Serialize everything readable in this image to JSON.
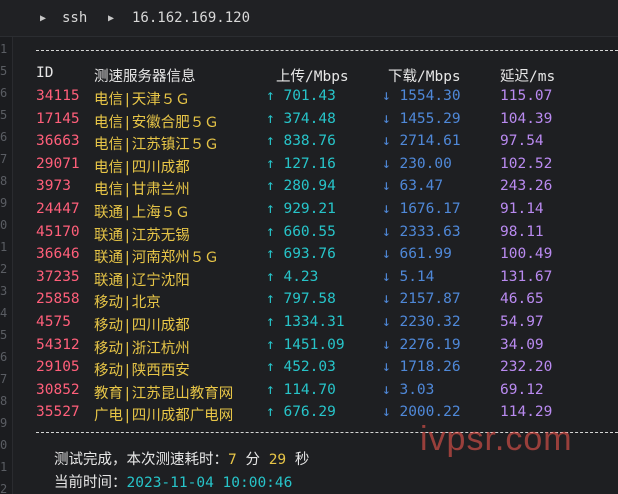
{
  "titlebar": {
    "app": "ssh",
    "host": "16.162.169.120"
  },
  "table": {
    "headers": {
      "id": "ID",
      "server": "测速服务器信息",
      "upload": "上传/Mbps",
      "download": "下载/Mbps",
      "latency": "延迟/ms"
    },
    "arrow_up": "↑",
    "arrow_down": "↓",
    "rows": [
      {
        "id": "34115",
        "name": "电信|天津５Ｇ",
        "up": "701.43",
        "down": "1554.30",
        "lat": "115.07"
      },
      {
        "id": "17145",
        "name": "电信|安徽合肥５Ｇ",
        "up": "374.48",
        "down": "1455.29",
        "lat": "104.39"
      },
      {
        "id": "36663",
        "name": "电信|江苏镇江５Ｇ",
        "up": "838.76",
        "down": "2714.61",
        "lat": "97.54"
      },
      {
        "id": "29071",
        "name": "电信|四川成都",
        "up": "127.16",
        "down": "230.00",
        "lat": "102.52"
      },
      {
        "id": "3973",
        "name": "电信|甘肃兰州",
        "up": "280.94",
        "down": "63.47",
        "lat": "243.26"
      },
      {
        "id": "24447",
        "name": "联通|上海５Ｇ",
        "up": "929.21",
        "down": "1676.17",
        "lat": "91.14"
      },
      {
        "id": "45170",
        "name": "联通|江苏无锡",
        "up": "660.55",
        "down": "2333.63",
        "lat": "98.11"
      },
      {
        "id": "36646",
        "name": "联通|河南郑州５Ｇ",
        "up": "693.76",
        "down": "661.99",
        "lat": "100.49"
      },
      {
        "id": "37235",
        "name": "联通|辽宁沈阳",
        "up": "4.23",
        "down": "5.14",
        "lat": "131.67"
      },
      {
        "id": "25858",
        "name": "移动|北京",
        "up": "797.58",
        "down": "2157.87",
        "lat": "46.65"
      },
      {
        "id": "4575",
        "name": "移动|四川成都",
        "up": "1334.31",
        "down": "2230.32",
        "lat": "54.97"
      },
      {
        "id": "54312",
        "name": "移动|浙江杭州",
        "up": "1451.09",
        "down": "2276.19",
        "lat": "34.09"
      },
      {
        "id": "29105",
        "name": "移动|陕西西安",
        "up": "452.03",
        "down": "1718.26",
        "lat": "232.20"
      },
      {
        "id": "30852",
        "name": "教育|江苏昆山教育网",
        "up": "114.70",
        "down": "3.03",
        "lat": "69.12"
      },
      {
        "id": "35527",
        "name": "广电|四川成都广电网",
        "up": "676.29",
        "down": "2000.22",
        "lat": "114.29"
      }
    ]
  },
  "footer": {
    "done_label": "测试完成，本次测速耗时：",
    "minutes": "7",
    "min_unit": "分",
    "seconds": "29",
    "sec_unit": "秒",
    "time_label": "当前时间：",
    "time_value": "2023-11-04 10:00:46"
  },
  "watermark": "ivpsr.com",
  "gutter_marks": [
    "1",
    "5",
    "6",
    "5",
    "6",
    "7",
    "8",
    "9",
    "0",
    "1",
    "2",
    "3",
    "4",
    "5",
    "6",
    "7",
    "8",
    "9",
    "0",
    "1",
    "2"
  ],
  "colors": {
    "id": "#ff5f7a",
    "name": "#e7c547",
    "upload": "#27c4c9",
    "download": "#4f88d8",
    "latency": "#b98af0"
  }
}
